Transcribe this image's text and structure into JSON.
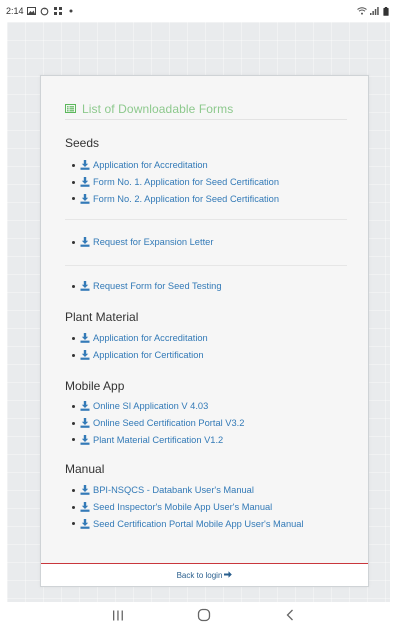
{
  "status_bar": {
    "time": "2:14",
    "left_icons": [
      "gallery-icon",
      "sync-icon",
      "grid-icon",
      "dot-icon"
    ],
    "right_icons": [
      "wifi-icon",
      "signal-icon",
      "battery-icon"
    ]
  },
  "panel": {
    "title": "List of Downloadable Forms",
    "title_color": "#8dc98d",
    "link_color": "#337ab7",
    "accent_border_color": "#c9363c"
  },
  "sections": {
    "seeds": {
      "heading": "Seeds",
      "group1": [
        "Application for Accreditation",
        "Form No. 1. Application for Seed Certification",
        "Form No. 2. Application for Seed Certification"
      ],
      "group2": [
        "Request for Expansion Letter"
      ],
      "group3": [
        "Request Form for Seed Testing"
      ]
    },
    "plant_material": {
      "heading": "Plant Material",
      "items": [
        "Application for Accreditation",
        "Application for Certification"
      ]
    },
    "mobile_app": {
      "heading": "Mobile App",
      "items": [
        "Online SI Application V 4.03",
        "Online Seed Certification Portal V3.2",
        "Plant Material Certification V1.2"
      ]
    },
    "manual": {
      "heading": "Manual",
      "items": [
        "BPI-NSQCS - Databank User's Manual",
        "Seed Inspector's Mobile App User's Manual",
        "Seed Certification Portal Mobile App User's Manual"
      ]
    }
  },
  "footer": {
    "back_label": "Back to login"
  },
  "nav_bar": {
    "buttons": [
      "recents-icon",
      "home-icon",
      "back-icon"
    ]
  }
}
